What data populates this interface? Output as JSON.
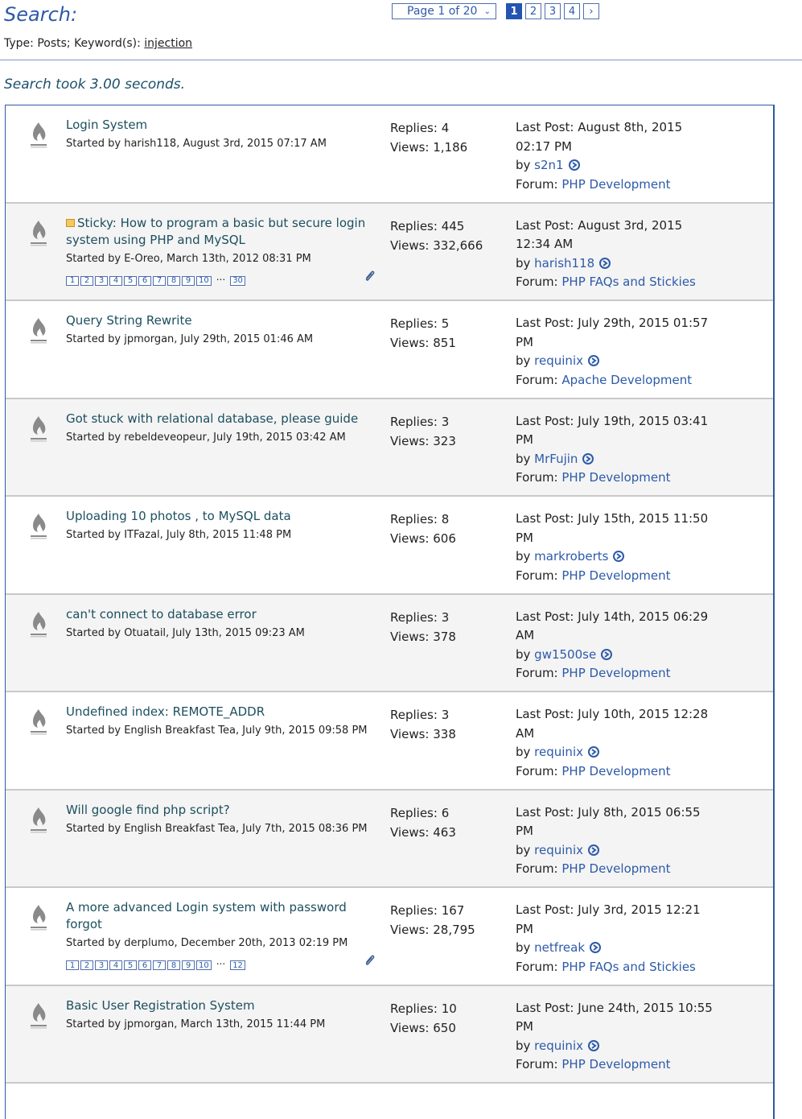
{
  "header": {
    "title": "Search:",
    "type_prefix": "Type: Posts; Keyword(s): ",
    "keyword": "injection",
    "search_time": "Search took 3.00 seconds."
  },
  "pager": {
    "select_label": "Page 1 of 20",
    "pages": [
      "1",
      "2",
      "3",
      "4"
    ],
    "current": "1",
    "next": "›"
  },
  "colors": {
    "accent": "#2e5aa8",
    "title_text": "#1c4f5f",
    "alt_row": "#f4f4f4"
  },
  "threads": [
    {
      "title": "Login System",
      "starter": "Started by harish118, August 3rd, 2015 07:17 AM",
      "replies": "Replies: 4",
      "views": "Views: 1,186",
      "last_post": "Last Post: August 8th, 2015 02:17 PM",
      "by_label": "by ",
      "by_user": "s2n1",
      "forum_label": "Forum: ",
      "forum": "PHP Development"
    },
    {
      "title": "Sticky: How to program a basic but secure login system using PHP and MySQL",
      "sticky": true,
      "starter": "Started by E-Oreo, March 13th, 2012 08:31 PM",
      "pages": [
        "1",
        "2",
        "3",
        "4",
        "5",
        "6",
        "7",
        "8",
        "9",
        "10"
      ],
      "last_page": "30",
      "attachment": true,
      "replies": "Replies: 445",
      "views": "Views: 332,666",
      "last_post": "Last Post: August 3rd, 2015 12:34 AM",
      "by_label": "by ",
      "by_user": "harish118",
      "forum_label": "Forum: ",
      "forum": "PHP FAQs and Stickies"
    },
    {
      "title": "Query String Rewrite",
      "starter": "Started by jpmorgan, July 29th, 2015 01:46 AM",
      "replies": "Replies: 5",
      "views": "Views: 851",
      "last_post": "Last Post: July 29th, 2015 01:57 PM",
      "by_label": "by ",
      "by_user": "requinix",
      "forum_label": "Forum: ",
      "forum": "Apache Development"
    },
    {
      "title": "Got stuck with relational database, please guide",
      "starter": "Started by rebeldeveopeur, July 19th, 2015 03:42 AM",
      "replies": "Replies: 3",
      "views": "Views: 323",
      "last_post": "Last Post: July 19th, 2015 03:41 PM",
      "by_label": "by ",
      "by_user": "MrFujin",
      "forum_label": "Forum: ",
      "forum": "PHP Development"
    },
    {
      "title": "Uploading 10 photos , to MySQL data",
      "starter": "Started by ITFazal, July 8th, 2015 11:48 PM",
      "replies": "Replies: 8",
      "views": "Views: 606",
      "last_post": "Last Post: July 15th, 2015 11:50 PM",
      "by_label": "by ",
      "by_user": "markroberts",
      "forum_label": "Forum: ",
      "forum": "PHP Development"
    },
    {
      "title": "can't connect to database error",
      "starter": "Started by Otuatail, July 13th, 2015 09:23 AM",
      "replies": "Replies: 3",
      "views": "Views: 378",
      "last_post": "Last Post: July 14th, 2015 06:29 AM",
      "by_label": "by ",
      "by_user": "gw1500se",
      "forum_label": "Forum: ",
      "forum": "PHP Development"
    },
    {
      "title": "Undefined index: REMOTE_ADDR",
      "starter": "Started by English Breakfast Tea, July 9th, 2015 09:58 PM",
      "replies": "Replies: 3",
      "views": "Views: 338",
      "last_post": "Last Post: July 10th, 2015 12:28 AM",
      "by_label": "by ",
      "by_user": "requinix",
      "forum_label": "Forum: ",
      "forum": "PHP Development"
    },
    {
      "title": "Will google find php script?",
      "starter": "Started by English Breakfast Tea, July 7th, 2015 08:36 PM",
      "replies": "Replies: 6",
      "views": "Views: 463",
      "last_post": "Last Post: July 8th, 2015 06:55 PM",
      "by_label": "by ",
      "by_user": "requinix",
      "forum_label": "Forum: ",
      "forum": "PHP Development"
    },
    {
      "title": "A more advanced Login system with password forgot",
      "starter": "Started by derplumo, December 20th, 2013 02:19 PM",
      "pages": [
        "1",
        "2",
        "3",
        "4",
        "5",
        "6",
        "7",
        "8",
        "9",
        "10"
      ],
      "last_page": "12",
      "attachment": true,
      "replies": "Replies: 167",
      "views": "Views: 28,795",
      "last_post": "Last Post: July 3rd, 2015 12:21 PM",
      "by_label": "by ",
      "by_user": "netfreak",
      "forum_label": "Forum: ",
      "forum": "PHP FAQs and Stickies"
    },
    {
      "title": "Basic User Registration System",
      "starter": "Started by jpmorgan, March 13th, 2015 11:44 PM",
      "replies": "Replies: 10",
      "views": "Views: 650",
      "last_post": "Last Post: June 24th, 2015 10:55 PM",
      "by_label": "by ",
      "by_user": "requinix",
      "forum_label": "Forum: ",
      "forum": "PHP Development"
    }
  ]
}
